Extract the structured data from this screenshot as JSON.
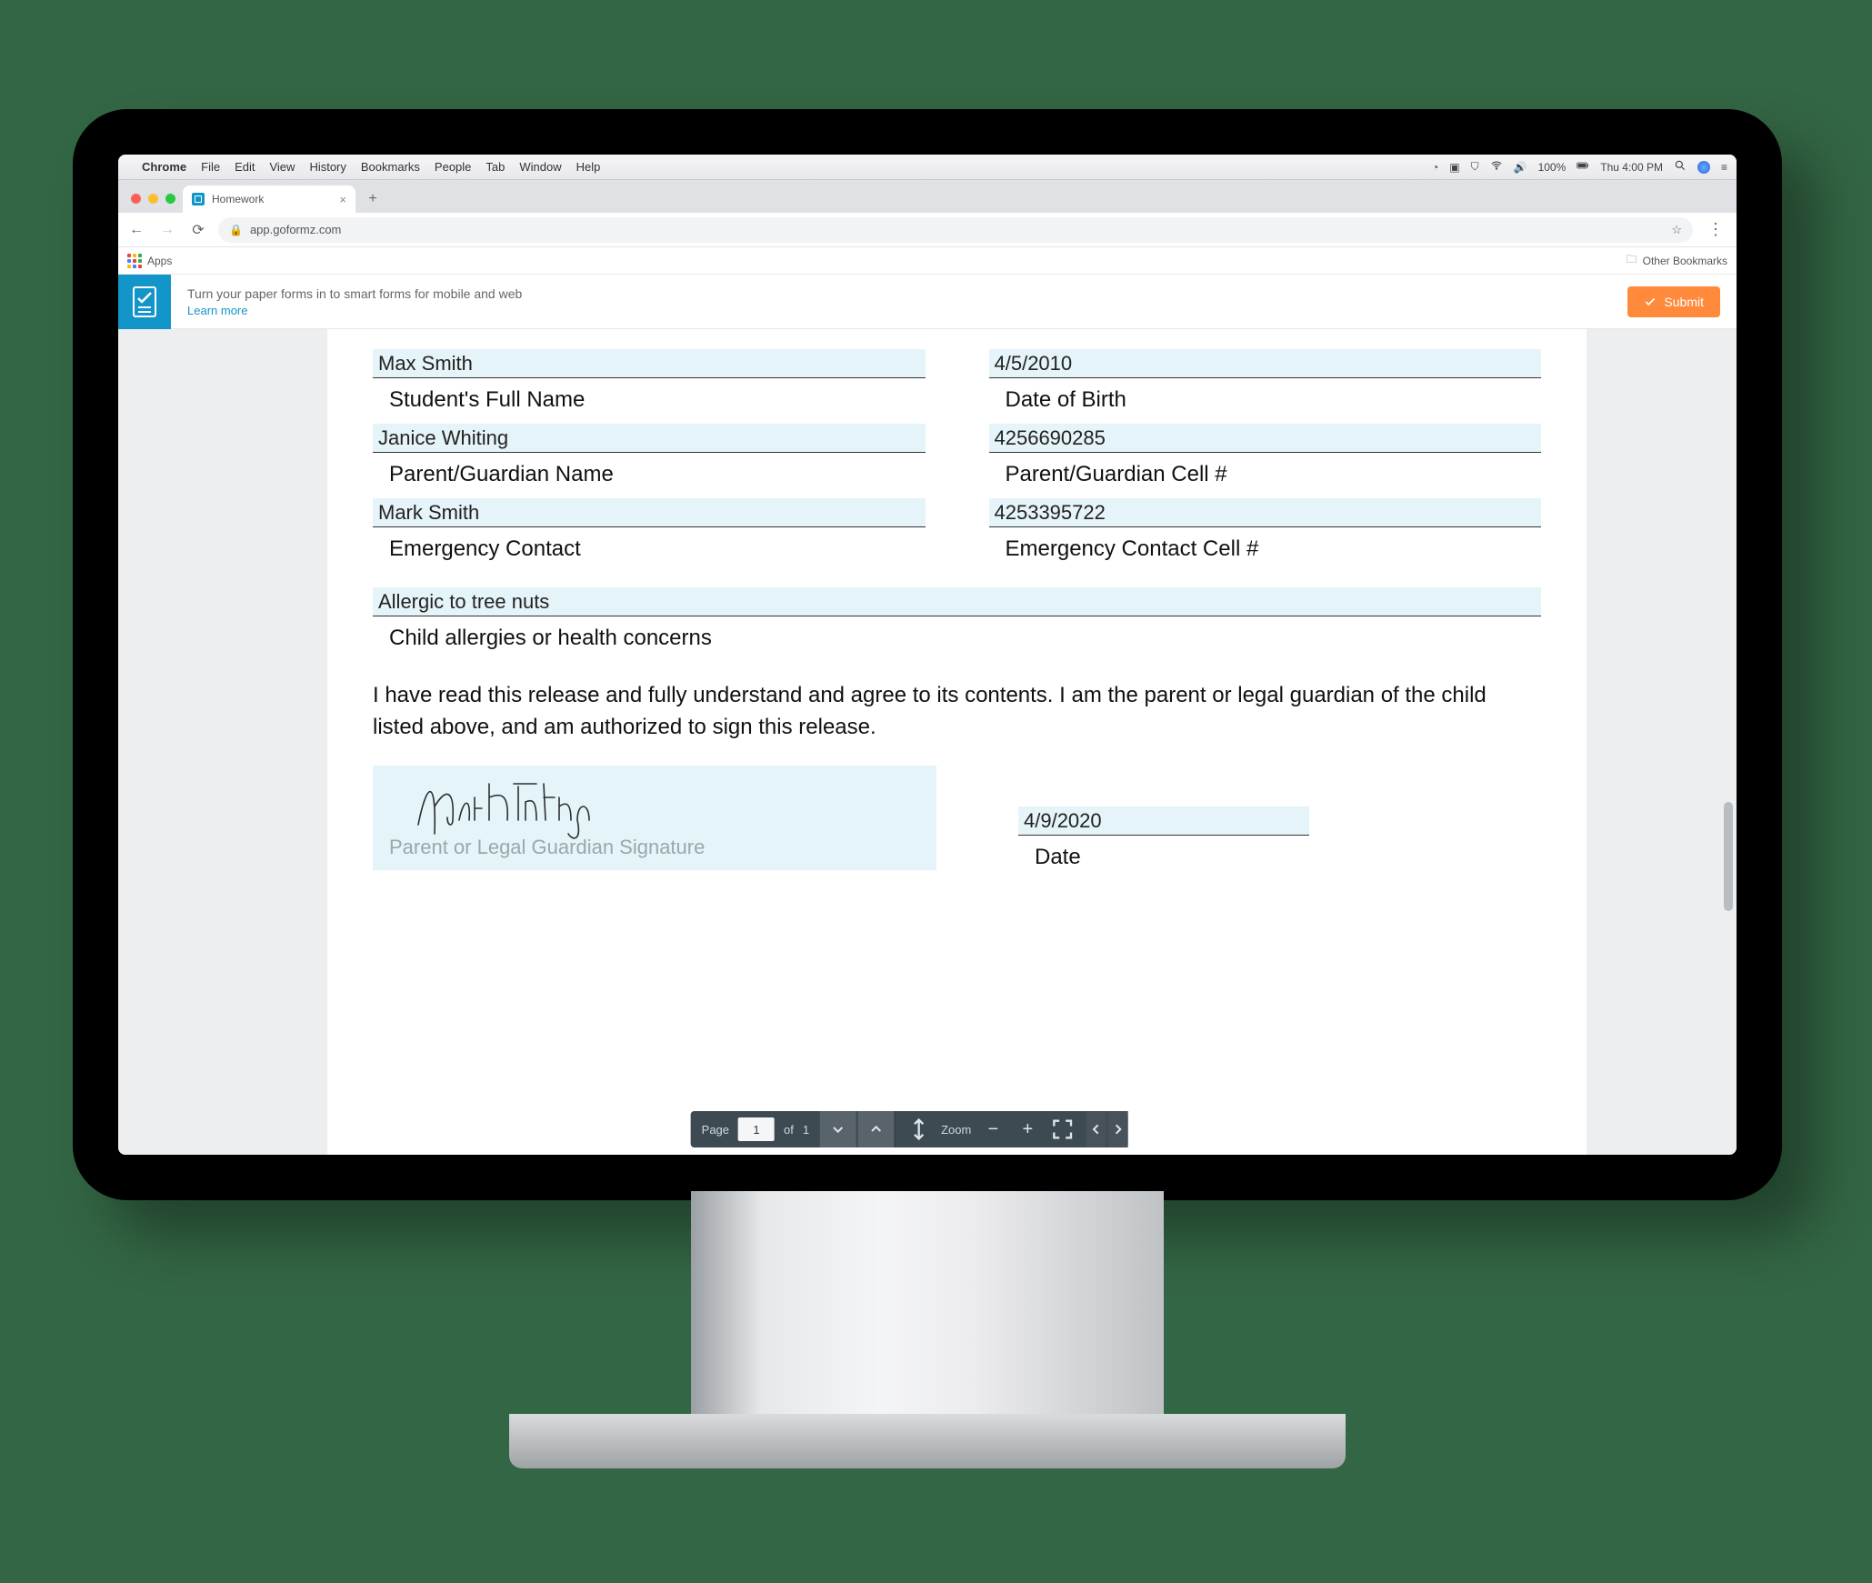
{
  "menubar": {
    "app": "Chrome",
    "items": [
      "File",
      "Edit",
      "View",
      "History",
      "Bookmarks",
      "People",
      "Tab",
      "Window",
      "Help"
    ],
    "battery": "100%",
    "time": "Thu 4:00 PM"
  },
  "browser": {
    "tab_title": "Homework",
    "url": "app.goformz.com",
    "apps_label": "Apps",
    "other_bookmarks": "Other Bookmarks"
  },
  "app_header": {
    "promo": "Turn your paper forms in to smart forms for mobile and web",
    "learn_more": "Learn more",
    "submit": "Submit"
  },
  "form": {
    "student_name": {
      "value": "Max Smith",
      "label": "Student's Full Name"
    },
    "dob": {
      "value": "4/5/2010",
      "label": "Date of Birth"
    },
    "parent_name": {
      "value": "Janice Whiting",
      "label": "Parent/Guardian Name"
    },
    "parent_cell": {
      "value": "4256690285",
      "label": "Parent/Guardian Cell #"
    },
    "emergency_contact": {
      "value": "Mark Smith",
      "label": "Emergency Contact"
    },
    "emergency_cell": {
      "value": "4253395722",
      "label": "Emergency Contact Cell #"
    },
    "allergies": {
      "value": "Allergic to tree nuts",
      "label": "Child allergies or health concerns"
    },
    "release_text": "I have read this release and fully understand and agree to its contents. I am the parent or legal guardian of the child listed above, and am authorized to sign this release.",
    "signature_placeholder": "Parent or Legal Guardian Signature",
    "sign_date": {
      "value": "4/9/2020",
      "label": "Date"
    }
  },
  "toolbar": {
    "page_label": "Page",
    "page_current": "1",
    "of_label": "of",
    "page_total": "1",
    "zoom_label": "Zoom"
  }
}
